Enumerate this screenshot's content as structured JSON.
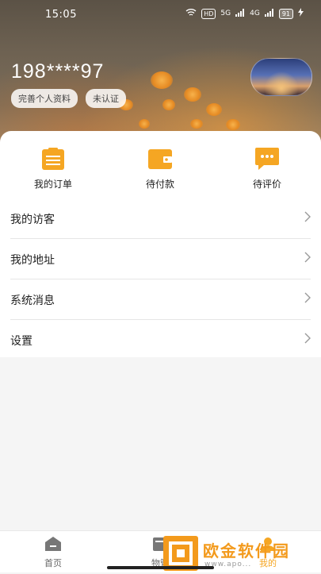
{
  "status_bar": {
    "time": "15:05",
    "hd": "HD",
    "net1": "5G",
    "net2": "4G",
    "battery": "91"
  },
  "profile": {
    "phone": "198****97",
    "tags": [
      "完善个人资料",
      "未认证"
    ]
  },
  "orders": [
    {
      "label": "我的订单",
      "icon": "order-list-icon"
    },
    {
      "label": "待付款",
      "icon": "wallet-icon"
    },
    {
      "label": "待评价",
      "icon": "comment-icon"
    }
  ],
  "menu": [
    {
      "label": "我的访客"
    },
    {
      "label": "我的地址"
    },
    {
      "label": "系统消息"
    },
    {
      "label": "设置"
    }
  ],
  "nav": [
    {
      "label": "首页",
      "icon": "home-icon"
    },
    {
      "label": "物管",
      "icon": "property-icon"
    },
    {
      "label": "我的",
      "icon": "me-icon"
    }
  ],
  "watermark": {
    "text": "欧金软件园",
    "url": "www.apo..."
  },
  "colors": {
    "accent": "#f5a623"
  }
}
